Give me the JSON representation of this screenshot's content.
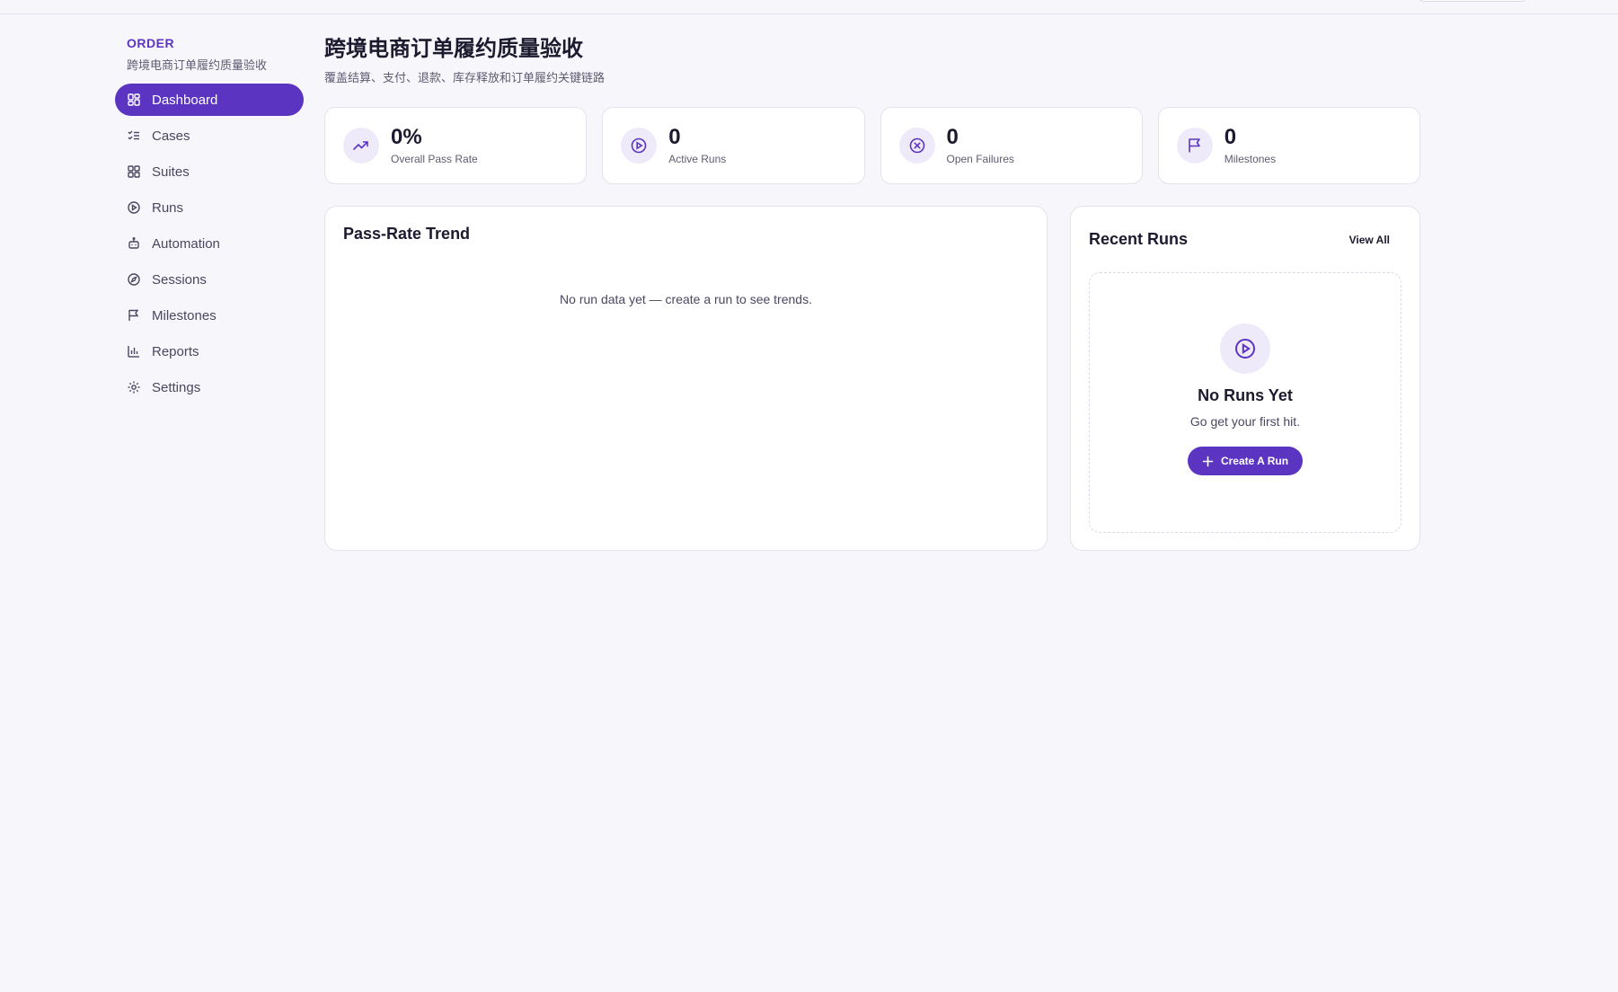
{
  "brand": {
    "name": "ORDER",
    "subtitle": "跨境电商订单履约质量验收"
  },
  "nav": [
    {
      "label": "Dashboard",
      "icon": "dashboard-icon",
      "active": true
    },
    {
      "label": "Cases",
      "icon": "checklist-icon"
    },
    {
      "label": "Suites",
      "icon": "grid-icon"
    },
    {
      "label": "Runs",
      "icon": "play-circle-icon"
    },
    {
      "label": "Automation",
      "icon": "bot-icon"
    },
    {
      "label": "Sessions",
      "icon": "compass-icon"
    },
    {
      "label": "Milestones",
      "icon": "flag-icon"
    },
    {
      "label": "Reports",
      "icon": "bar-chart-icon"
    },
    {
      "label": "Settings",
      "icon": "gear-icon"
    }
  ],
  "header": {
    "title": "跨境电商订单履约质量验收",
    "subtitle": "覆盖结算、支付、退款、库存释放和订单履约关键链路"
  },
  "stats": [
    {
      "value": "0%",
      "label": "Overall Pass Rate",
      "icon": "trending-up-icon"
    },
    {
      "value": "0",
      "label": "Active Runs",
      "icon": "play-circle-icon"
    },
    {
      "value": "0",
      "label": "Open Failures",
      "icon": "x-circle-icon"
    },
    {
      "value": "0",
      "label": "Milestones",
      "icon": "flag-icon"
    }
  ],
  "trend": {
    "title": "Pass-Rate Trend",
    "empty_text": "No run data yet — create a run to see trends."
  },
  "recent_runs": {
    "title": "Recent Runs",
    "view_all": "View All",
    "empty_title": "No Runs Yet",
    "empty_sub": "Go get your first hit.",
    "create_label": "Create A Run"
  },
  "colors": {
    "accent": "#5b34c1",
    "accent_soft": "#efeaf9",
    "background": "#f7f6fb"
  }
}
